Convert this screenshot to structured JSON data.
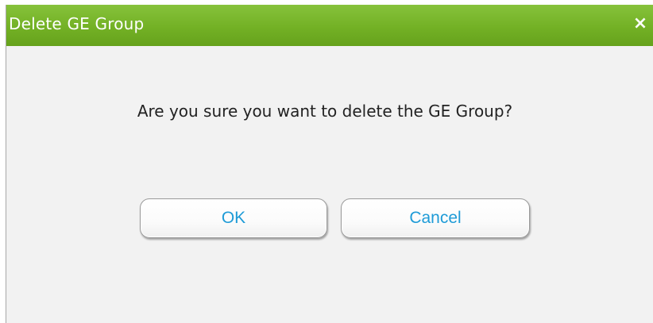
{
  "dialog": {
    "title": "Delete GE Group",
    "close_symbol": "×",
    "message": "Are you sure you want to delete the GE Group?",
    "ok_label": "OK",
    "cancel_label": "Cancel"
  },
  "colors": {
    "titlebar_green": "#73b125",
    "button_text_blue": "#1e9bd7",
    "dialog_background": "#f2f2f2"
  },
  "icons": {
    "close": "close-icon"
  }
}
